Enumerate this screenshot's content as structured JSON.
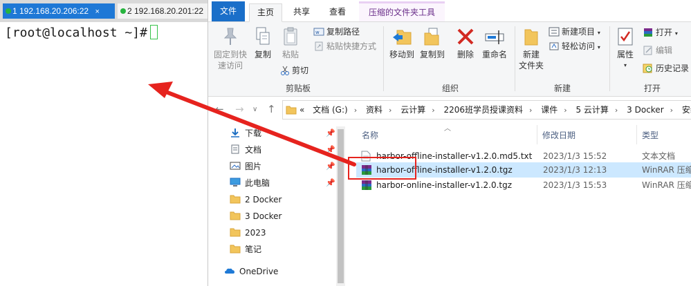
{
  "terminal": {
    "tabs": [
      {
        "label": "1 192.168.20.206:22",
        "close": "×"
      },
      {
        "label": "2 192.168.20.201:22",
        "close": ""
      }
    ],
    "prompt": "[root@localhost ~]#"
  },
  "explorer": {
    "ribbon_tabs": {
      "file": "文件",
      "home": "主页",
      "share": "共享",
      "view": "查看",
      "tools": "压缩的文件夹工具"
    },
    "clipboard": {
      "pin_line1": "固定到快",
      "pin_line2": "速访问",
      "copy": "复制",
      "paste": "粘贴",
      "copy_path": "复制路径",
      "paste_shortcut": "粘贴快捷方式",
      "cut": "剪切",
      "label": "剪贴板"
    },
    "organize": {
      "move_to": "移动到",
      "copy_to": "复制到",
      "delete": "删除",
      "rename": "重命名",
      "label": "组织"
    },
    "new": {
      "new_folder_line1": "新建",
      "new_folder_line2": "文件夹",
      "new_item": "新建项目",
      "easy_access": "轻松访问",
      "label": "新建"
    },
    "open": {
      "properties": "属性",
      "open": "打开",
      "edit": "编辑",
      "history": "历史记录",
      "label": "打开"
    },
    "address": {
      "prefix": "«",
      "crumbs": [
        "文档 (G:)",
        "资料",
        "云计算",
        "2206班学员授课资料",
        "课件",
        "5 云计算",
        "3 Docker",
        "安装包"
      ]
    },
    "nav": {
      "items": [
        {
          "label": "下载",
          "icon": "download-icon",
          "pinned": true
        },
        {
          "label": "文档",
          "icon": "document-icon",
          "pinned": true
        },
        {
          "label": "图片",
          "icon": "picture-icon",
          "pinned": true
        },
        {
          "label": "此电脑",
          "icon": "computer-icon",
          "pinned": true
        },
        {
          "label": "2 Docker",
          "icon": "folder-icon",
          "pinned": false
        },
        {
          "label": "3 Docker",
          "icon": "folder-icon",
          "pinned": false
        },
        {
          "label": "2023",
          "icon": "folder-icon",
          "pinned": false
        },
        {
          "label": "笔记",
          "icon": "folder-icon",
          "pinned": false
        },
        {
          "label": "OneDrive",
          "icon": "cloud-icon",
          "pinned": false
        }
      ]
    },
    "columns": {
      "name": "名称",
      "date": "修改日期",
      "type": "类型"
    },
    "files": [
      {
        "name": "harbor-offline-installer-v1.2.0.md5.txt",
        "date": "2023/1/3 15:52",
        "type": "文本文档",
        "icon": "text-file-icon"
      },
      {
        "name": "harbor-offline-installer-v1.2.0.tgz",
        "date": "2023/1/3 12:13",
        "type": "WinRAR 压缩文件",
        "icon": "winrar-archive-icon",
        "selected": true
      },
      {
        "name": "harbor-online-installer-v1.2.0.tgz",
        "date": "2023/1/3 15:53",
        "type": "WinRAR 压缩文件",
        "icon": "winrar-archive-icon"
      }
    ]
  },
  "colors": {
    "accent_blue": "#1a6fc9",
    "selection": "#cce8ff",
    "annotation_red": "#e6231e",
    "terminal_tab_active": "#1e78d6",
    "cursor_green": "#36c24a"
  }
}
